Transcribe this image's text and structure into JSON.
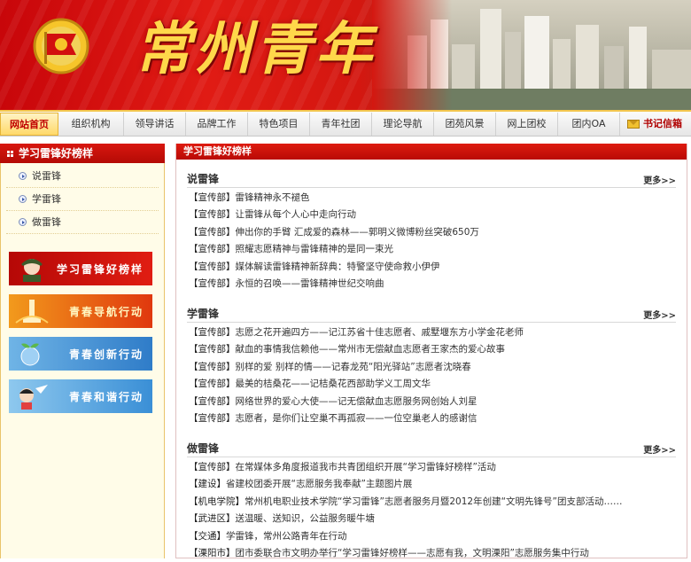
{
  "banner": {
    "title": "常州青年",
    "emblem_text": "中国共青团"
  },
  "nav": [
    {
      "label": "网站首页",
      "active": true
    },
    {
      "label": "组织机构"
    },
    {
      "label": "领导讲话"
    },
    {
      "label": "品牌工作"
    },
    {
      "label": "特色项目"
    },
    {
      "label": "青年社团"
    },
    {
      "label": "理论导航"
    },
    {
      "label": "团苑风景"
    },
    {
      "label": "网上团校"
    },
    {
      "label": "团内OA"
    },
    {
      "label": "书记信箱",
      "icon": "envelope-icon"
    }
  ],
  "sidebar": {
    "title": "学习雷锋好榜样",
    "links": [
      "说雷锋",
      "学雷锋",
      "做雷锋"
    ],
    "promos": [
      "学习雷锋好榜样",
      "青春导航行动",
      "青春创新行动",
      "青春和谐行动"
    ]
  },
  "main": {
    "header": "学习雷锋好榜样",
    "more_label": "更多>>",
    "sections": [
      {
        "title": "说雷锋",
        "items": [
          {
            "src": "【宣传部】",
            "text": "雷锋精神永不褪色"
          },
          {
            "src": "【宣传部】",
            "text": "让雷锋从每个人心中走向行动"
          },
          {
            "src": "【宣传部】",
            "text": "伸出你的手臂  汇成爱的森林——郭明义微博粉丝突破650万"
          },
          {
            "src": "【宣传部】",
            "text": "照耀志愿精神与雷锋精神的是同一束光"
          },
          {
            "src": "【宣传部】",
            "text": "媒体解读雷锋精神新辞典：特警坚守使命救小伊伊"
          },
          {
            "src": "【宣传部】",
            "text": "永恒的召唤——雷锋精神世纪交响曲"
          }
        ]
      },
      {
        "title": "学雷锋",
        "items": [
          {
            "src": "【宣传部】",
            "text": "志愿之花开遍四方——记江苏省十佳志愿者、戚墅堰东方小学金花老师"
          },
          {
            "src": "【宣传部】",
            "text": "献血的事情我信赖他——常州市无偿献血志愿者王家杰的爱心故事"
          },
          {
            "src": "【宣传部】",
            "text": "别样的爱  别样的情——记春龙苑“阳光驿站”志愿者沈晓春"
          },
          {
            "src": "【宣传部】",
            "text": "最美的桔桑花——记桔桑花西部助学义工周文华"
          },
          {
            "src": "【宣传部】",
            "text": "网络世界的爱心大使——记无偿献血志愿服务网创始人刘星"
          },
          {
            "src": "【宣传部】",
            "text": "志愿者，是你们让空巢不再孤寂——一位空巢老人的感谢信"
          }
        ]
      },
      {
        "title": "做雷锋",
        "items": [
          {
            "src": "【宣传部】",
            "text": "在常媒体多角度报道我市共青团组织开展“学习雷锋好榜样”活动"
          },
          {
            "src": "【建设】",
            "text": "省建校团委开展“志愿服务我奉献”主题图片展"
          },
          {
            "src": "【机电学院】",
            "text": "常州机电职业技术学院“学习雷锋”志愿者服务月暨2012年创建“文明先锋号”团支部活动……"
          },
          {
            "src": "【武进区】",
            "text": "送温暖、送知识，公益服务暖牛塘"
          },
          {
            "src": "【交通】",
            "text": "学雷锋，常州公路青年在行动"
          },
          {
            "src": "【溧阳市】",
            "text": "团市委联合市文明办举行“学习雷锋好榜样——志愿有我，文明溧阳”志愿服务集中行动"
          }
        ]
      }
    ]
  },
  "colors": {
    "brand_red": "#c8060a",
    "gold": "#ffd84a",
    "nav_bg": "#eeeeee",
    "sidebar_bg": "#fffce8"
  }
}
